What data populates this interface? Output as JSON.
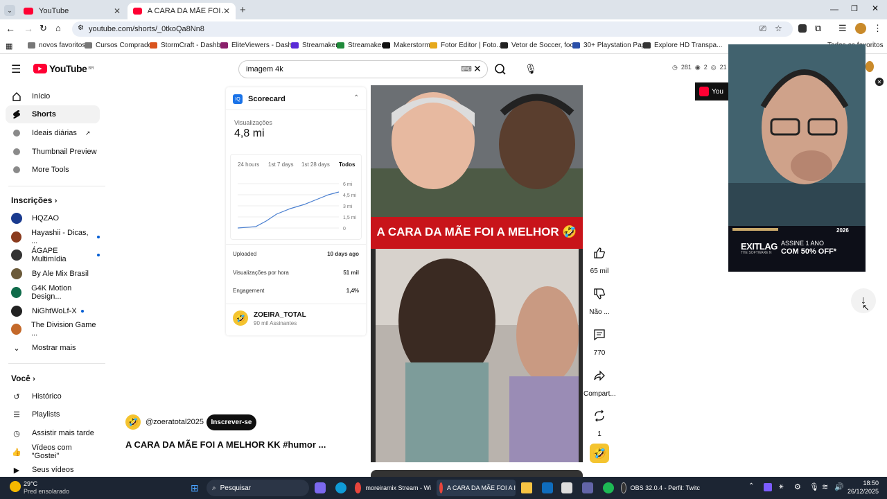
{
  "browser": {
    "tabs": [
      {
        "label": "YouTube",
        "active": false
      },
      {
        "label": "A CARA DA MÃE FOI A MELHOR",
        "active": true
      }
    ],
    "url": "youtube.com/shorts/_0tkoQa8Nn8",
    "bookmarks": [
      "novos favoritos",
      "Cursos Comprados",
      "StormCraft - Dashb...",
      "EliteViewers - Dash...",
      "Streamaker",
      "Streamaker",
      "Makerstorm",
      "Fotor Editor | Foto...",
      "Vetor de Soccer, foo...",
      "30+ Playstation Pap...",
      "Explore HD Transpa...",
      "Todos os favoritos"
    ]
  },
  "youtube": {
    "logo_text": "YouTube",
    "logo_region": "BR",
    "search": {
      "value": "imagem 4k"
    },
    "header_stats": {
      "views": "281",
      "eye": "2",
      "watch": "21"
    }
  },
  "sidebar": {
    "main": [
      {
        "label": "Início",
        "icon": "home-icon"
      },
      {
        "label": "Shorts",
        "icon": "shorts-icon",
        "active": true
      },
      {
        "label": "Ideais diárias",
        "icon": "ext-icon"
      },
      {
        "label": "Thumbnail Preview",
        "icon": "ext-icon"
      },
      {
        "label": "More Tools",
        "icon": "ext-icon"
      }
    ],
    "subscriptions_title": "Inscrições",
    "subscriptions": [
      {
        "label": "HQZAO",
        "color": "#1a3a8f",
        "dot": false
      },
      {
        "label": "Hayashii - Dicas, ...",
        "color": "#8a3b1e",
        "dot": true
      },
      {
        "label": "ÁGAPE Multimídia",
        "color": "#333333",
        "dot": true
      },
      {
        "label": "By Ale Mix Brasil",
        "color": "#6b5a3a",
        "dot": false
      },
      {
        "label": "G4K Motion Design...",
        "color": "#0f6b4a",
        "dot": false
      },
      {
        "label": "NiGhtWoLf-X",
        "color": "#222222",
        "dot": true
      },
      {
        "label": "The Division Game ...",
        "color": "#c4692a",
        "dot": false
      }
    ],
    "show_more": "Mostrar mais",
    "you_title": "Você",
    "you": [
      {
        "label": "Histórico",
        "icon": "history-icon"
      },
      {
        "label": "Playlists",
        "icon": "playlist-icon"
      },
      {
        "label": "Assistir mais tarde",
        "icon": "clock-icon"
      },
      {
        "label": "Vídeos com \"Gostei\"",
        "icon": "like-icon"
      },
      {
        "label": "Seus vídeos",
        "icon": "video-icon"
      }
    ]
  },
  "scorecard": {
    "title": "Scorecard",
    "views_label": "Visualizações",
    "views_value": "4,8 mi",
    "ranges": [
      "24 hours",
      "1st 7 days",
      "1st 28 days",
      "Todos"
    ],
    "y_ticks": [
      "6 mi",
      "4,5 mi",
      "3 mi",
      "1,5 mi",
      "0"
    ],
    "rows": [
      {
        "label": "Uploaded",
        "value": "10 days ago"
      },
      {
        "label": "Visualizações por hora",
        "value": "51 mil"
      },
      {
        "label": "Engagement",
        "value": "1,4%"
      }
    ],
    "channel_name": "ZOEIRA_TOTAL",
    "channel_subs": "90 mil Assinantes"
  },
  "short": {
    "banner_text": "A CARA DA MÃE FOI A MELHOR 🤣",
    "channel_handle": "@zoeratotal2025",
    "subscribe_label": "Inscrever-se",
    "title": "A CARA DA MÃE FOI A MELHOR KK #humor ...",
    "likes": "65 mil",
    "dislike": "Não ...",
    "comments": "770",
    "share": "Compart...",
    "remix": "1"
  },
  "overlay": {
    "ad_brand": "EXITLAG",
    "ad_sub": "THE SOFTWARE N",
    "ad_cta_line1": "ASSINE 1 ANO",
    "ad_cta_line2": "COM 50% OFF*",
    "ad_year": "2026",
    "overlay_label": "You"
  },
  "taskbar": {
    "weather_temp": "29°C",
    "weather_desc": "Pred ensolarado",
    "search": "Pesquisar",
    "apps": [
      "moreiramix Stream - Wi",
      "A CARA DA MÃE FOI A I",
      "OBS 32.0.4 - Perfil: Twitc"
    ],
    "time": "18:50",
    "date": "26/12/2025"
  }
}
